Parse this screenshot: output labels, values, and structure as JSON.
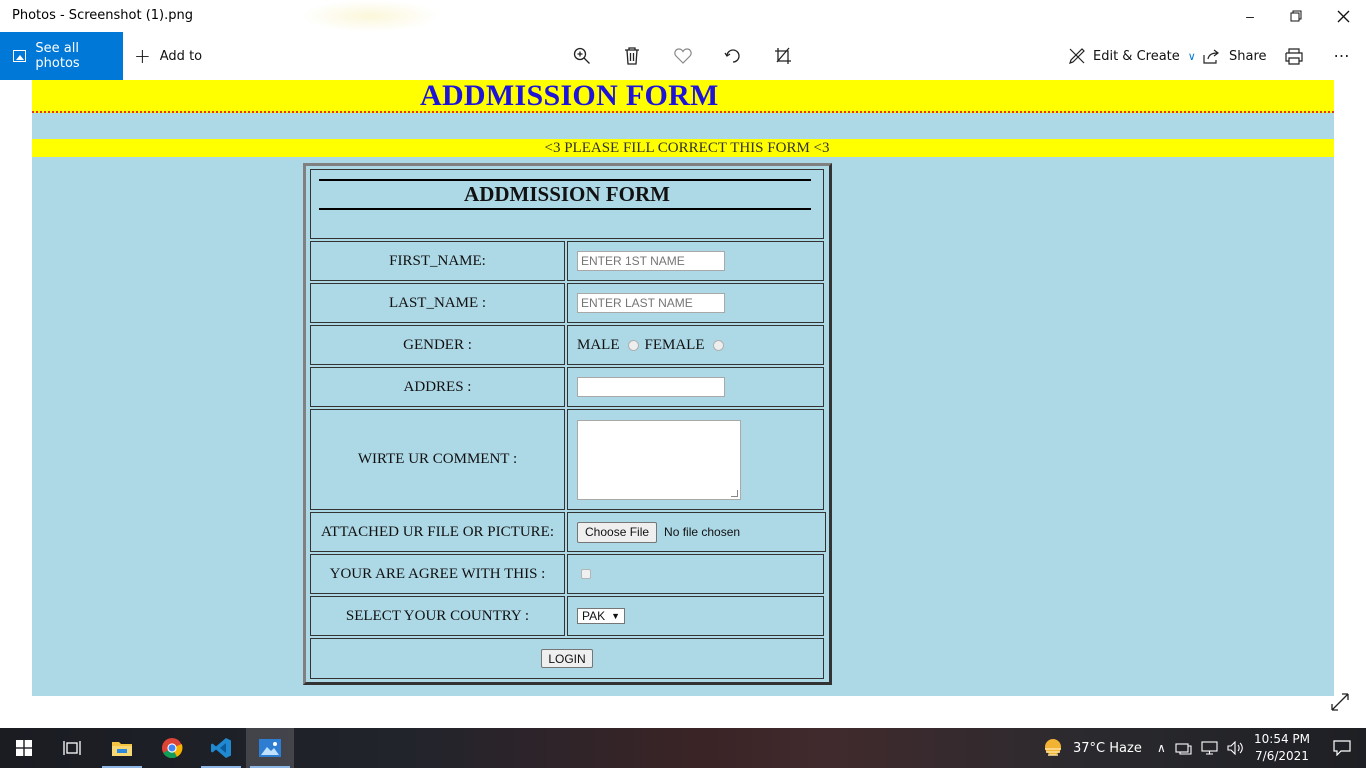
{
  "window": {
    "title": "Photos - Screenshot (1).png",
    "minimize_icon": "minimize-icon",
    "restore_icon": "restore-icon",
    "close_icon": "close-icon"
  },
  "toolbar": {
    "see_all_label": "See all photos",
    "add_to_label": "Add to",
    "edit_create_label": "Edit & Create",
    "share_label": "Share",
    "icons": [
      "zoom-icon",
      "delete-icon",
      "favorite-icon",
      "rotate-icon",
      "crop-icon",
      "print-icon",
      "more-icon"
    ]
  },
  "page": {
    "banner_title": "ADDMISSION FORM",
    "notice": "<3 PLEASE FILL CORRECT THIS FORM <3",
    "background_color": "#add8e6",
    "band_color": "#ffff00",
    "title_color": "#1e14d8"
  },
  "form": {
    "heading": "ADDMISSION FORM",
    "first_name_label": "FIRST_NAME:",
    "first_name_placeholder": "ENTER 1ST NAME",
    "last_name_label": "LAST_NAME :",
    "last_name_placeholder": "ENTER LAST NAME",
    "gender_label": "GENDER :",
    "gender_options": [
      "MALE",
      "FEMALE"
    ],
    "address_label": "ADDRES :",
    "address_value": "",
    "comment_label": "WIRTE UR COMMENT :",
    "file_label": "ATTACHED UR FILE OR PICTURE:",
    "file_button": "Choose File",
    "file_status": "No file chosen",
    "agree_label": "YOUR ARE AGREE WITH THIS :",
    "country_label": "SELECT YOUR COUNTRY :",
    "country_selected": "PAK",
    "submit_label": "LOGIN"
  },
  "taskbar": {
    "apps": [
      "windows-start-icon",
      "task-view-icon",
      "file-explorer-icon",
      "chrome-icon",
      "vscode-icon",
      "photos-icon"
    ],
    "weather": "37°C  Haze",
    "time": "10:54 PM",
    "date": "7/6/2021"
  }
}
